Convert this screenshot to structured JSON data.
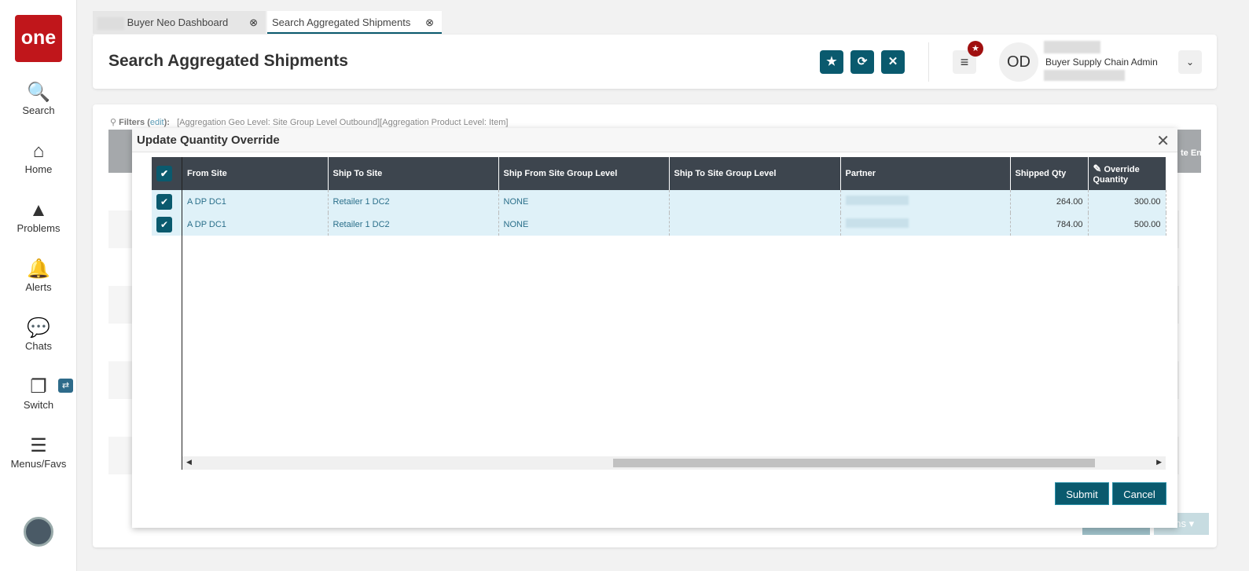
{
  "sidebar": {
    "logo": "one",
    "items": [
      {
        "label": "Search",
        "icon": "search-icon",
        "glyph": "🔍"
      },
      {
        "label": "Home",
        "icon": "home-icon",
        "glyph": "⌂"
      },
      {
        "label": "Problems",
        "icon": "warning-icon",
        "glyph": "▲"
      },
      {
        "label": "Alerts",
        "icon": "bell-icon",
        "glyph": "🔔"
      },
      {
        "label": "Chats",
        "icon": "chat-icon",
        "glyph": "💬"
      },
      {
        "label": "Switch",
        "icon": "switch-icon",
        "glyph": "❐"
      },
      {
        "label": "Menus/Favs",
        "icon": "menu-icon",
        "glyph": "☰"
      }
    ],
    "switch_badge": "⇄"
  },
  "tabs": [
    {
      "label": "Buyer Neo Dashboard"
    },
    {
      "label": "Search Aggregated Shipments"
    }
  ],
  "header": {
    "title": "Search Aggregated Shipments",
    "avatar": "OD",
    "role": "Buyer Supply Chain Admin"
  },
  "filters": {
    "label": "Filters",
    "edit": "edit",
    "text": "[Aggregation Geo Level: Site Group Level Outbound][Aggregation Product Level: Item]"
  },
  "modal": {
    "title": "Update Quantity Override",
    "columns": [
      "From Site",
      "Ship To Site",
      "Ship From Site Group Level",
      "Ship To Site Group Level",
      "Partner",
      "Shipped Qty",
      "Override Quantity"
    ],
    "rows": [
      {
        "from": "A DP DC1",
        "to": "Retailer 1 DC2",
        "from_group": "NONE",
        "to_group": "",
        "shipped": "264.00",
        "override": "300.00"
      },
      {
        "from": "A DP DC1",
        "to": "Retailer 1 DC2",
        "from_group": "NONE",
        "to_group": "",
        "shipped": "784.00",
        "override": "500.00"
      }
    ],
    "submit": "Submit",
    "cancel": "Cancel"
  },
  "background": {
    "partial_header": "te Ent",
    "partial_button": "ons"
  }
}
